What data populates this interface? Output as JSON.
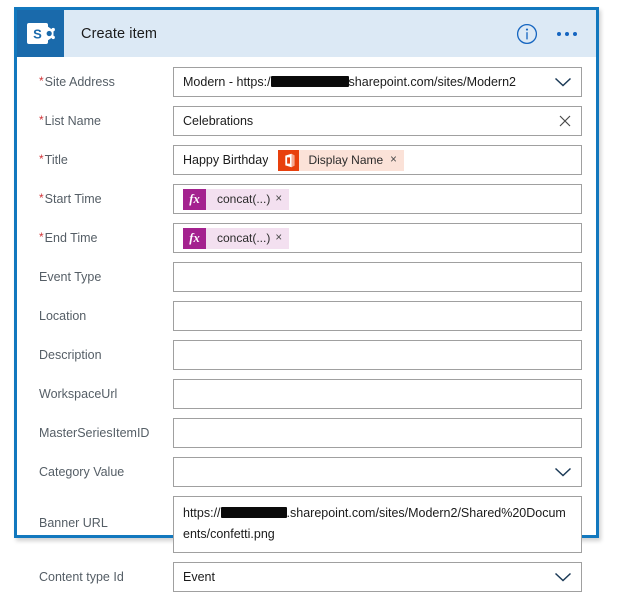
{
  "window": {
    "app_icon": "sharepoint-icon",
    "title": "Create item",
    "info_icon": "info-icon",
    "more_icon": "ellipsis-icon",
    "accent_color": "#1278be",
    "header_bg": "#dce9f5",
    "logo_bg": "#1a6aab"
  },
  "form": {
    "required_marker": "*",
    "fields": [
      {
        "label": "Site Address",
        "required": true,
        "type": "dropdown",
        "value_prefix": "Modern - https:/",
        "value_suffix": "sharepoint.com/sites/Modern2",
        "redacted": true,
        "affix": "chevron-down-icon"
      },
      {
        "label": "List Name",
        "required": true,
        "type": "text",
        "value": "Celebrations",
        "affix": "clear-icon"
      },
      {
        "label": "Title",
        "required": true,
        "type": "token-text",
        "value": "Happy Birthday",
        "token": {
          "badge": "office-icon",
          "label": "Display Name",
          "remove": "×",
          "bg": "#fbe2d8",
          "badge_bg": "#e8400d"
        }
      },
      {
        "label": "Start Time",
        "required": true,
        "type": "token",
        "token": {
          "badge": "fx",
          "label": "concat(...)",
          "remove": "×",
          "bg": "#f3e0f0",
          "badge_bg": "#a4228f"
        }
      },
      {
        "label": "End Time",
        "required": true,
        "type": "token",
        "token": {
          "badge": "fx",
          "label": "concat(...)",
          "remove": "×",
          "bg": "#f3e0f0",
          "badge_bg": "#a4228f"
        }
      },
      {
        "label": "Event Type",
        "required": false,
        "type": "text",
        "value": ""
      },
      {
        "label": "Location",
        "required": false,
        "type": "text",
        "value": ""
      },
      {
        "label": "Description",
        "required": false,
        "type": "text",
        "value": ""
      },
      {
        "label": "WorkspaceUrl",
        "required": false,
        "type": "text",
        "value": ""
      },
      {
        "label": "MasterSeriesItemID",
        "required": false,
        "type": "text",
        "value": ""
      },
      {
        "label": "Category Value",
        "required": false,
        "type": "dropdown",
        "value": "",
        "affix": "chevron-down-icon"
      },
      {
        "label": "Banner URL",
        "required": false,
        "type": "textarea",
        "value_prefix": "https://",
        "value_suffix": ".sharepoint.com/sites/Modern2/Shared%20Documents/confetti.png",
        "redacted": true
      },
      {
        "label": "Content type Id",
        "required": false,
        "type": "dropdown",
        "value": "Event",
        "affix": "chevron-down-icon"
      }
    ]
  }
}
